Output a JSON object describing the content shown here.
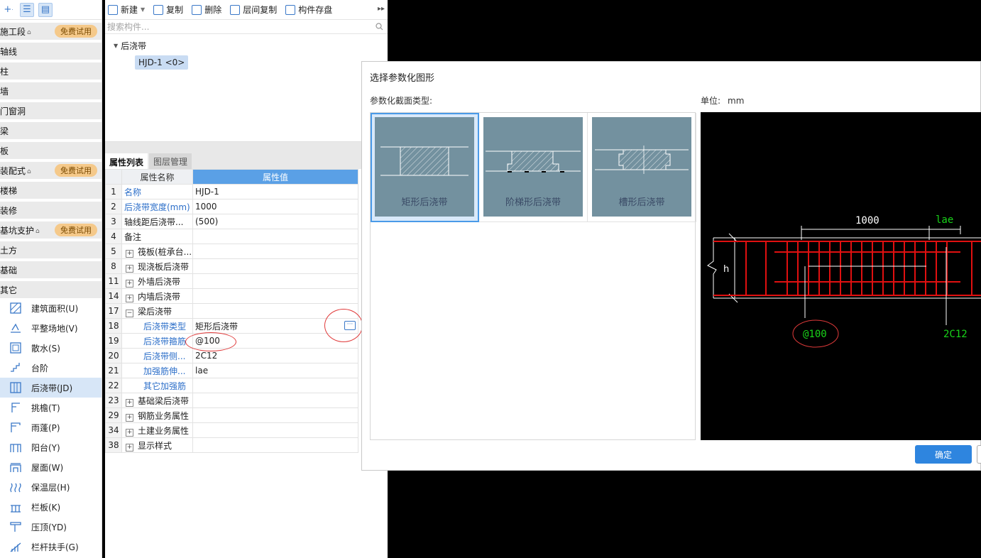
{
  "left_panel": {
    "categories": [
      {
        "label": "施工段",
        "lock": true,
        "badge": "免费试用"
      },
      {
        "label": "轴线"
      },
      {
        "label": "柱"
      },
      {
        "label": "墙"
      },
      {
        "label": "门窗洞"
      },
      {
        "label": "梁"
      },
      {
        "label": "板"
      },
      {
        "label": "装配式",
        "lock": true,
        "badge": "免费试用"
      },
      {
        "label": "楼梯"
      },
      {
        "label": "装修"
      },
      {
        "label": "基坑支护",
        "lock": true,
        "badge": "免费试用"
      },
      {
        "label": "土方"
      },
      {
        "label": "基础"
      },
      {
        "label": "其它"
      }
    ],
    "items": [
      {
        "label": "建筑面积(U)",
        "icon": "building-area-icon"
      },
      {
        "label": "平整场地(V)",
        "icon": "site-leveling-icon"
      },
      {
        "label": "散水(S)",
        "icon": "apron-icon"
      },
      {
        "label": "台阶",
        "icon": "steps-icon"
      },
      {
        "label": "后浇带(JD)",
        "icon": "post-cast-strip-icon",
        "selected": true
      },
      {
        "label": "挑檐(T)",
        "icon": "cornice-icon"
      },
      {
        "label": "雨蓬(P)",
        "icon": "canopy-icon"
      },
      {
        "label": "阳台(Y)",
        "icon": "balcony-icon"
      },
      {
        "label": "屋面(W)",
        "icon": "roof-icon"
      },
      {
        "label": "保温层(H)",
        "icon": "insulation-icon"
      },
      {
        "label": "栏板(K)",
        "icon": "breast-board-icon"
      },
      {
        "label": "压顶(YD)",
        "icon": "coping-icon"
      },
      {
        "label": "栏杆扶手(G)",
        "icon": "railing-icon"
      }
    ]
  },
  "toolbar": {
    "new": "新建",
    "copy": "复制",
    "delete": "删除",
    "floor_copy": "层间复制",
    "save_component": "构件存盘"
  },
  "search": {
    "placeholder": "搜索构件..."
  },
  "tree": {
    "root": "后浇带",
    "leaf": "HJD-1 <0>"
  },
  "prop_tabs": {
    "props": "属性列表",
    "layers": "图层管理"
  },
  "props_header": {
    "name": "属性名称",
    "value": "属性值"
  },
  "props_rows": [
    {
      "num": "1",
      "name": "名称",
      "value": "HJD-1",
      "blue": true
    },
    {
      "num": "2",
      "name": "后浇带宽度(mm)",
      "value": "1000",
      "blue": true
    },
    {
      "num": "3",
      "name": "轴线距后浇带...",
      "value": "(500)"
    },
    {
      "num": "4",
      "name": "备注",
      "value": ""
    },
    {
      "num": "5",
      "name": "筏板(桩承台...",
      "value": "",
      "plus": "+"
    },
    {
      "num": "8",
      "name": "现浇板后浇带",
      "value": "",
      "plus": "+"
    },
    {
      "num": "11",
      "name": "外墙后浇带",
      "value": "",
      "plus": "+"
    },
    {
      "num": "14",
      "name": "内墙后浇带",
      "value": "",
      "plus": "+"
    },
    {
      "num": "17",
      "name": "梁后浇带",
      "value": "",
      "plus": "−"
    },
    {
      "num": "18",
      "name": "后浇带类型",
      "value": "矩形后浇带",
      "blue": true,
      "child": true,
      "current": true
    },
    {
      "num": "19",
      "name": "后浇带箍筋",
      "value": "@100",
      "blue": true,
      "child": true
    },
    {
      "num": "20",
      "name": "后浇带侧...",
      "value": "2C12",
      "blue": true,
      "child": true
    },
    {
      "num": "21",
      "name": "加强筋伸...",
      "value": "lae",
      "blue": true,
      "child": true
    },
    {
      "num": "22",
      "name": "其它加强筋",
      "value": "",
      "blue": true,
      "child": true
    },
    {
      "num": "23",
      "name": "基础梁后浇带",
      "value": "",
      "plus": "+"
    },
    {
      "num": "29",
      "name": "钢筋业务属性",
      "value": "",
      "plus": "+"
    },
    {
      "num": "34",
      "name": "土建业务属性",
      "value": "",
      "plus": "+"
    },
    {
      "num": "38",
      "name": "显示样式",
      "value": "",
      "plus": "+"
    }
  ],
  "dialog": {
    "title": "选择参数化图形",
    "section_label": "参数化截面类型:",
    "unit_label": "单位:",
    "unit_value": "mm",
    "shapes": [
      {
        "caption": "矩形后浇带",
        "selected": true
      },
      {
        "caption": "阶梯形后浇带"
      },
      {
        "caption": "槽形后浇带"
      }
    ],
    "preview": {
      "width_label": "1000",
      "anchor_label": "lae",
      "height_label": "h",
      "stirrup_label": "@100",
      "rebar_label": "2C12"
    },
    "ok": "确定"
  },
  "colors": {
    "accent": "#2e85df",
    "selection": "#d7e6f7",
    "badge": "#f5c98a",
    "rebar_red": "#e01010",
    "label_green": "#19d319"
  }
}
